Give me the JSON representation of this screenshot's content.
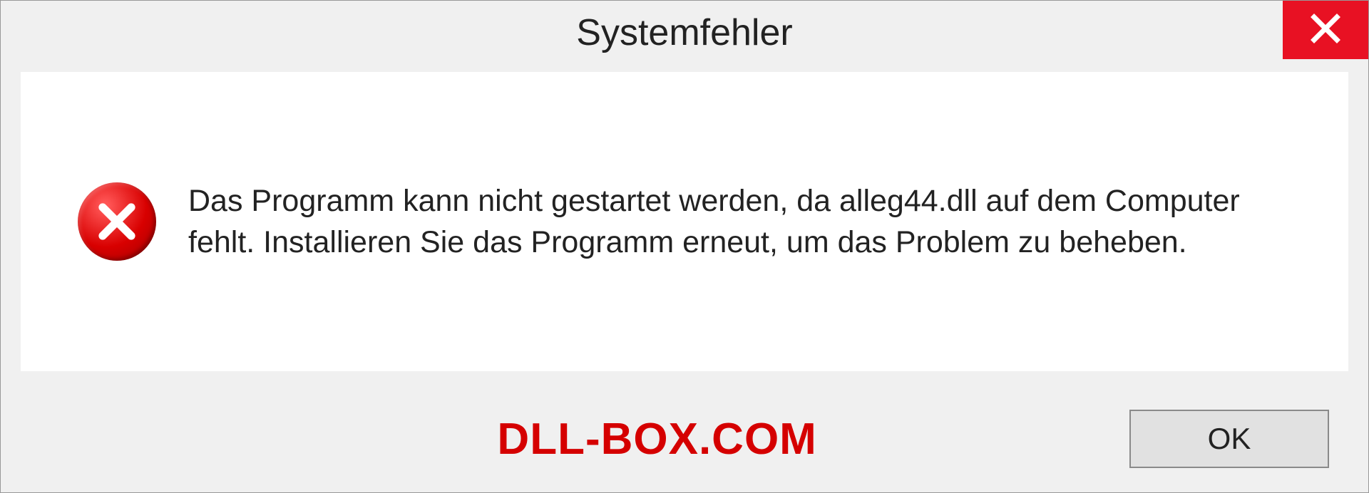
{
  "dialog": {
    "title": "Systemfehler",
    "message": "Das Programm kann nicht gestartet werden, da alleg44.dll auf dem Computer fehlt. Installieren Sie das Programm erneut, um das Problem zu beheben.",
    "ok_label": "OK"
  },
  "watermark": "DLL-BOX.COM"
}
